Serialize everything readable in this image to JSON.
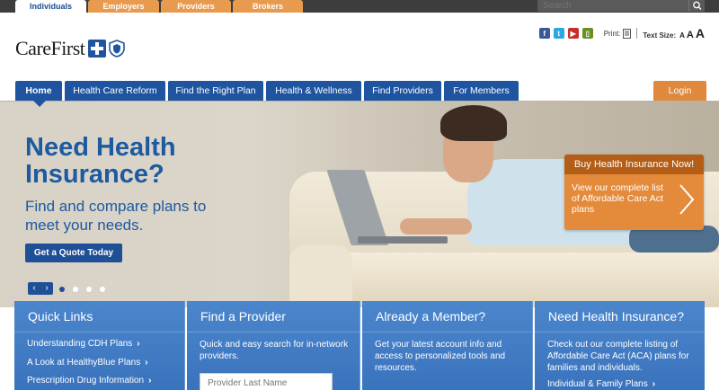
{
  "audience_tabs": [
    {
      "label": "Individuals",
      "active": true
    },
    {
      "label": "Employers",
      "active": false
    },
    {
      "label": "Providers",
      "active": false
    },
    {
      "label": "Brokers",
      "active": false
    }
  ],
  "search": {
    "placeholder": "Search"
  },
  "logo": {
    "text": "CareFirst"
  },
  "utilities": {
    "social_icons": [
      "facebook-icon",
      "twitter-icon",
      "youtube-icon",
      "mobile-icon"
    ],
    "print_label": "Print:",
    "text_size_label": "Text Size:",
    "text_sizes": [
      "A",
      "A",
      "A"
    ]
  },
  "nav": {
    "items": [
      "Home",
      "Health Care Reform",
      "Find the Right Plan",
      "Health & Wellness",
      "Find Providers",
      "For Members"
    ],
    "login": "Login"
  },
  "hero": {
    "title": "Need Health Insurance?",
    "subtitle": "Find and compare plans to meet your needs.",
    "cta": "Get a Quote Today",
    "prev": "‹",
    "next": "›",
    "slide_count": 4,
    "active_slide": 1
  },
  "promo": {
    "header": "Buy Health Insurance Now!",
    "body": "View our complete list of Affordable Care Act plans"
  },
  "panels": {
    "quick_links": {
      "title": "Quick Links",
      "links": [
        "Understanding CDH Plans",
        "A Look at HealthyBlue Plans",
        "Prescription Drug Information"
      ]
    },
    "find_provider": {
      "title": "Find a Provider",
      "text": "Quick and easy search for in-network providers.",
      "input_placeholder": "Provider Last Name"
    },
    "member": {
      "title": "Already a Member?",
      "text": "Get your latest account info and access to personalized tools and resources."
    },
    "need_insurance": {
      "title": "Need Health Insurance?",
      "text": "Check out our complete listing of Affordable Care Act (ACA) plans for families and individuals.",
      "link": "Individual & Family Plans"
    }
  },
  "colors": {
    "brand_blue": "#1f55a0",
    "accent_orange": "#e48a3b",
    "panel_blue": "#3f7bc4"
  }
}
